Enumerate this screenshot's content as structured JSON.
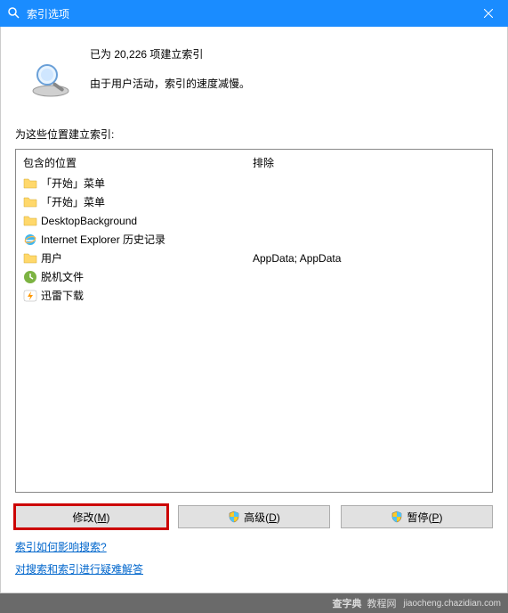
{
  "titlebar": {
    "title": "索引选项"
  },
  "info": {
    "indexed_count_line": "已为 20,226 项建立索引",
    "status_line": "由于用户活动，索引的速度减慢。"
  },
  "locations_label": "为这些位置建立索引:",
  "columns": {
    "included": "包含的位置",
    "excluded": "排除"
  },
  "items": [
    {
      "icon": "folder",
      "name": "「开始」菜单",
      "excluded": ""
    },
    {
      "icon": "folder",
      "name": "「开始」菜单",
      "excluded": ""
    },
    {
      "icon": "folder",
      "name": "DesktopBackground",
      "excluded": ""
    },
    {
      "icon": "ie",
      "name": "Internet Explorer 历史记录",
      "excluded": ""
    },
    {
      "icon": "folder",
      "name": "用户",
      "excluded": "AppData; AppData"
    },
    {
      "icon": "offline",
      "name": "脱机文件",
      "excluded": ""
    },
    {
      "icon": "thunder",
      "name": "迅雷下载",
      "excluded": ""
    }
  ],
  "buttons": {
    "modify": "修改",
    "modify_key": "M",
    "advanced": "高级",
    "advanced_key": "D",
    "pause": "暂停",
    "pause_key": "P"
  },
  "links": {
    "how_affects": "索引如何影响搜索?",
    "troubleshoot": "对搜索和索引进行疑难解答"
  },
  "watermark": {
    "logo": "查字典",
    "text": "教程网",
    "url": "jiaocheng.chazidian.com"
  }
}
